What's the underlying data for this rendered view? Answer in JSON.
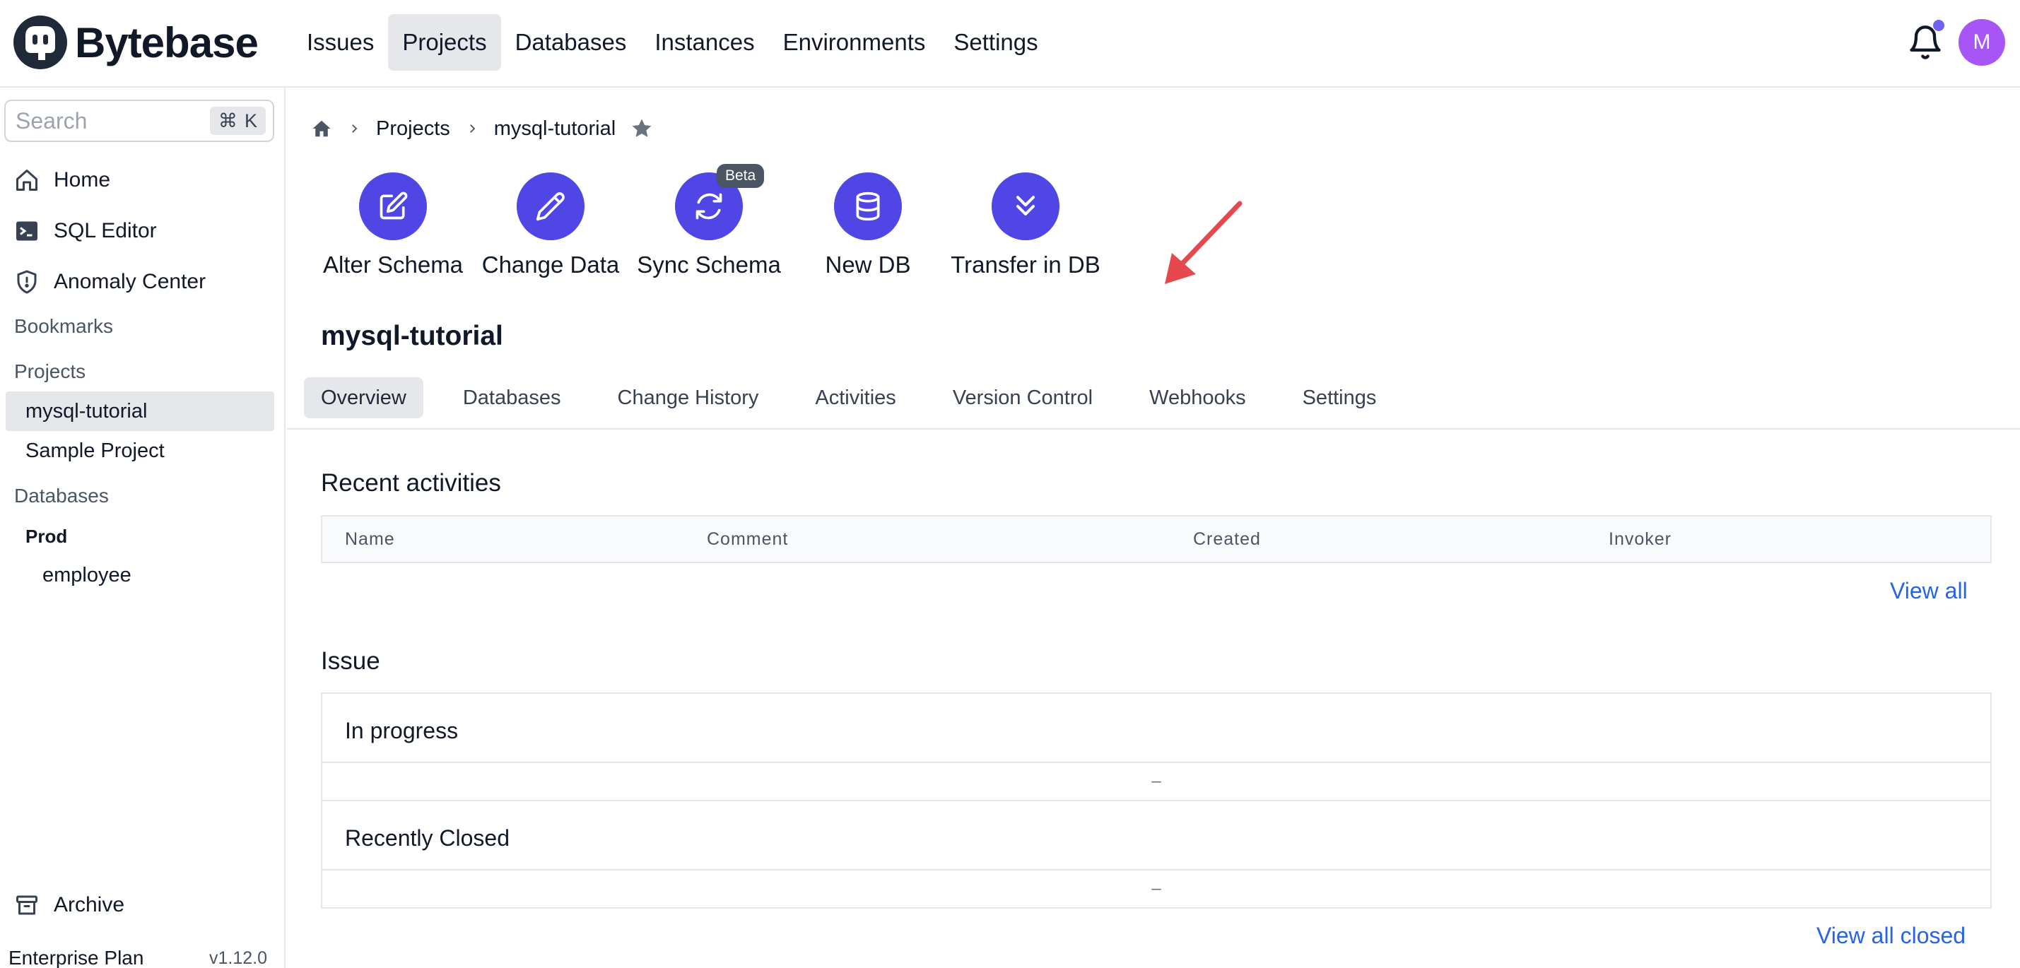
{
  "app": {
    "name": "Bytebase"
  },
  "nav": {
    "items": [
      "Issues",
      "Projects",
      "Databases",
      "Instances",
      "Environments",
      "Settings"
    ],
    "active": "Projects"
  },
  "user": {
    "initial": "M",
    "avatar_color": "#a855f7"
  },
  "sidebar": {
    "search_placeholder": "Search",
    "shortcut_symbol": "⌘",
    "shortcut_key": "K",
    "links": {
      "home": "Home",
      "sql_editor": "SQL Editor",
      "anomaly_center": "Anomaly Center"
    },
    "bookmarks_label": "Bookmarks",
    "projects_label": "Projects",
    "projects": [
      "mysql-tutorial",
      "Sample Project"
    ],
    "databases_label": "Databases",
    "environment": "Prod",
    "database": "employee",
    "archive": "Archive",
    "plan": "Enterprise Plan",
    "version": "v1.12.0"
  },
  "breadcrumb": {
    "projects": "Projects",
    "current": "mysql-tutorial"
  },
  "quick_actions": {
    "alter_schema": "Alter Schema",
    "change_data": "Change Data",
    "sync_schema": "Sync Schema",
    "sync_badge": "Beta",
    "new_db": "New DB",
    "transfer_in_db": "Transfer in DB"
  },
  "project": {
    "title": "mysql-tutorial"
  },
  "tabs": [
    "Overview",
    "Databases",
    "Change History",
    "Activities",
    "Version Control",
    "Webhooks",
    "Settings"
  ],
  "active_tab": "Overview",
  "recent_activities": {
    "title": "Recent activities",
    "columns": [
      "Name",
      "Comment",
      "Created",
      "Invoker"
    ],
    "view_all": "View all"
  },
  "issue": {
    "title": "Issue",
    "in_progress": "In progress",
    "in_progress_empty": "–",
    "recently_closed": "Recently Closed",
    "recently_closed_empty": "–",
    "view_all_closed": "View all closed"
  },
  "colors": {
    "accent": "#4f46e5",
    "link": "#2563eb",
    "annotation_arrow": "#e5484d"
  }
}
